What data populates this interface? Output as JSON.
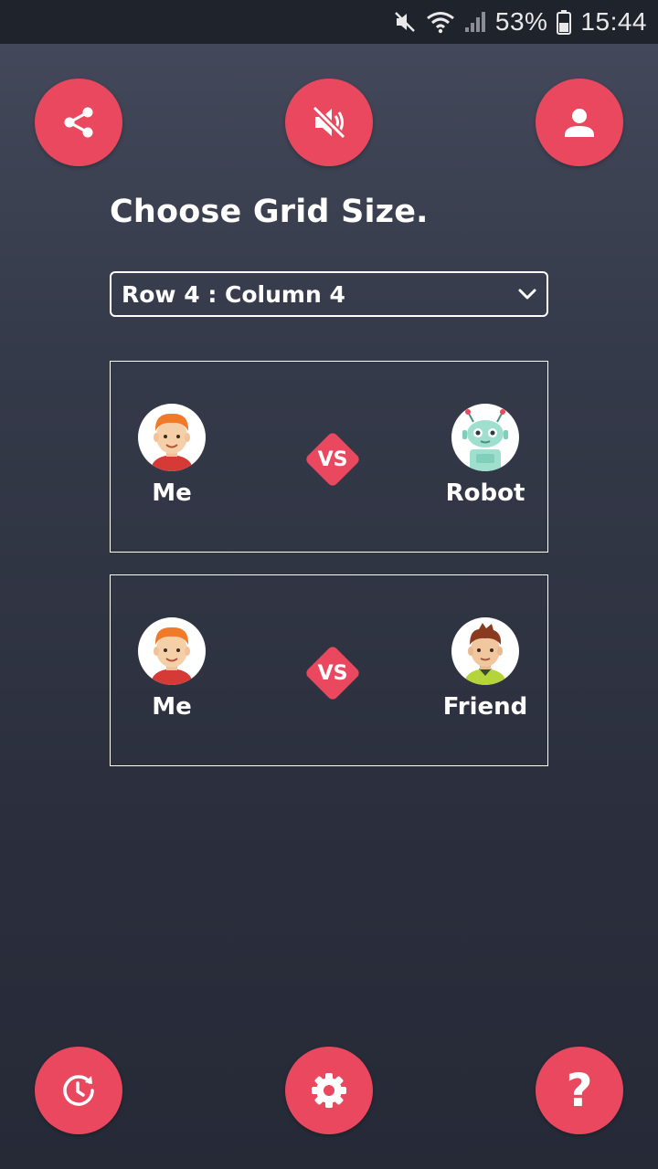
{
  "status_bar": {
    "battery": "53%",
    "time": "15:44",
    "icons": [
      "mute-icon",
      "wifi-icon",
      "signal-icon",
      "battery-icon"
    ]
  },
  "top_buttons": {
    "share": {
      "icon": "share-icon"
    },
    "sound": {
      "icon": "speaker-muted-icon"
    },
    "profile": {
      "icon": "person-icon"
    }
  },
  "title": "Choose Grid Size.",
  "grid_select": {
    "value": "Row 4 : Column 4"
  },
  "matches": [
    {
      "player1": {
        "name": "Me",
        "avatar": "boy-avatar"
      },
      "vs": "VS",
      "player2": {
        "name": "Robot",
        "avatar": "robot-avatar"
      }
    },
    {
      "player1": {
        "name": "Me",
        "avatar": "boy-avatar"
      },
      "vs": "VS",
      "player2": {
        "name": "Friend",
        "avatar": "friend-avatar"
      }
    }
  ],
  "bottom_buttons": {
    "history": {
      "icon": "history-icon"
    },
    "settings": {
      "icon": "gear-icon"
    },
    "help": {
      "label": "?"
    }
  },
  "colors": {
    "accent": "#e9485f",
    "background_top": "#454a5c",
    "background_bottom": "#262a37",
    "status_bar": "#1f232c"
  }
}
